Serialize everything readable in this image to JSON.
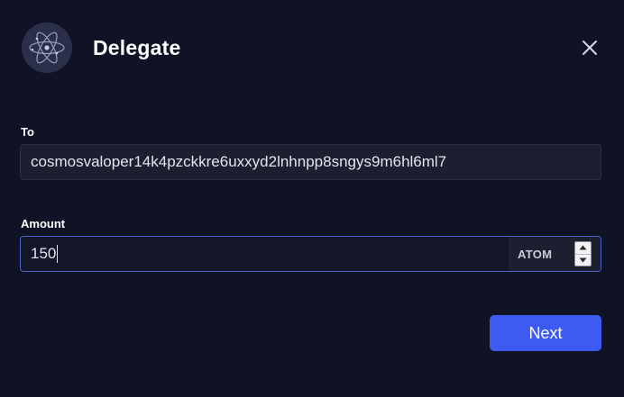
{
  "dialog": {
    "title": "Delegate",
    "logo_icon": "cosmos-atom-icon",
    "close_icon": "close-icon"
  },
  "to": {
    "label": "To",
    "value": "cosmosvaloper14k4pzckkre6uxxyd2lnhnpp8sngys9m6hl6ml7"
  },
  "amount": {
    "label": "Amount",
    "value": "150",
    "unit": "ATOM",
    "stepper_up_icon": "caret-up-icon",
    "stepper_down_icon": "caret-down-icon"
  },
  "actions": {
    "next_label": "Next"
  },
  "colors": {
    "background": "#0f1325",
    "field_background": "#1b1f30",
    "focus_border": "#4d63c9",
    "primary_button": "#3d5af1"
  }
}
